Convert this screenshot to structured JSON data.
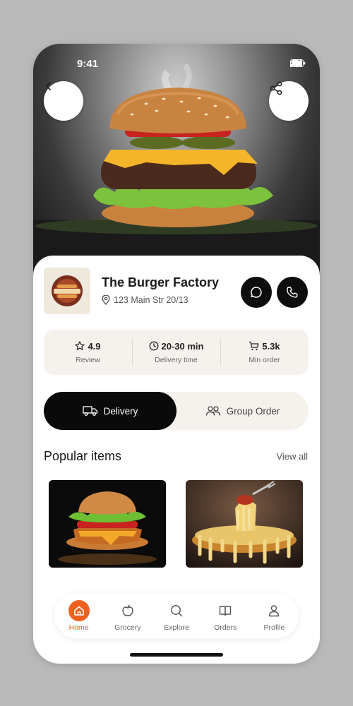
{
  "status": {
    "time": "9:41"
  },
  "hero": {
    "image": "cheeseburger-photo"
  },
  "restaurant": {
    "name": "The Burger Factory",
    "address": "123 Main Str 20/13",
    "logo": "burger-factory-logo"
  },
  "stats": [
    {
      "icon": "star-icon",
      "value": "4.9",
      "label": "Review"
    },
    {
      "icon": "clock-icon",
      "value": "20-30 min",
      "label": "Delivery time"
    },
    {
      "icon": "cart-icon",
      "value": "5.3k",
      "label": "Min order"
    }
  ],
  "order_mode": {
    "delivery_label": "Delivery",
    "group_label": "Group Order",
    "selected": "Delivery"
  },
  "popular": {
    "title": "Popular items",
    "view_all": "View all",
    "items": [
      {
        "image": "crispy-chicken-burger-photo",
        "name": ""
      },
      {
        "image": "cheese-pie-photo",
        "name": ""
      }
    ]
  },
  "tabbar": {
    "items": [
      {
        "icon": "home-icon",
        "label": "Home",
        "active": true
      },
      {
        "icon": "grocery-icon",
        "label": "Grocery",
        "active": false
      },
      {
        "icon": "search-icon",
        "label": "Explore",
        "active": false
      },
      {
        "icon": "orders-icon",
        "label": "Orders",
        "active": false
      },
      {
        "icon": "profile-icon",
        "label": "Profile",
        "active": false
      }
    ]
  },
  "colors": {
    "accent": "#f0611e",
    "dark": "#0a0a0a",
    "surface": "#f5f2ee"
  }
}
